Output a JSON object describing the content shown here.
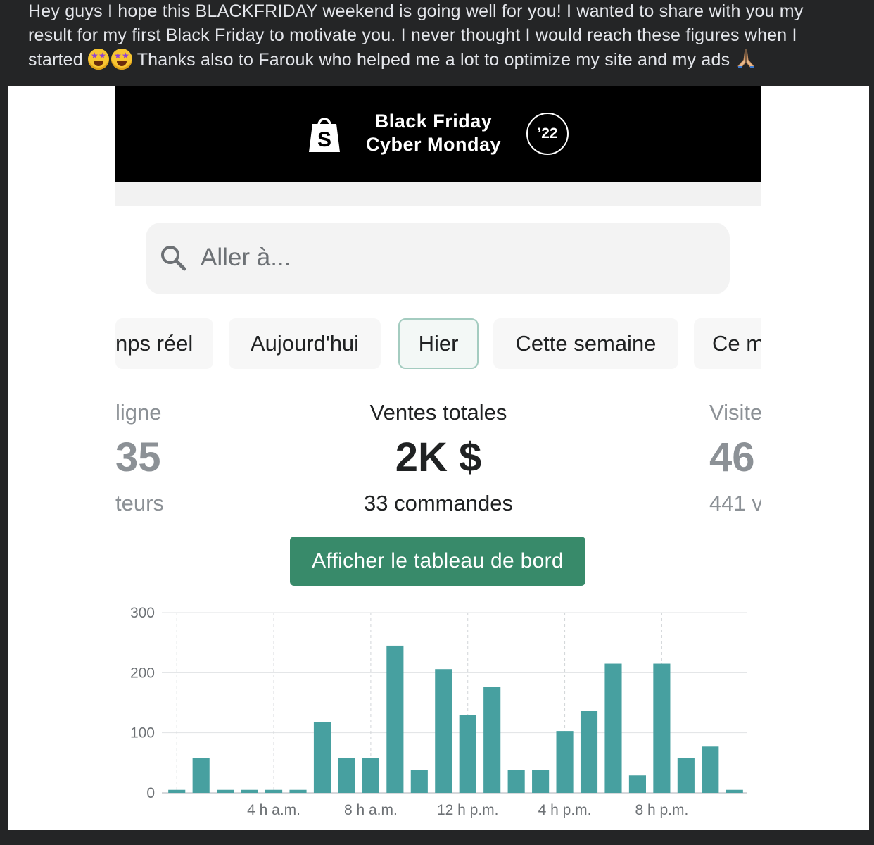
{
  "post": {
    "text_part1": "Hey guys I hope this BLACKFRIDAY weekend is going well for you! I wanted to share with you my result for my first Black Friday to motivate you. I never thought I would reach these figures when I started",
    "text_part2": "Thanks also to Farouk who helped me a lot to optimize my site and my ads",
    "emojis": [
      "star-struck-emoji",
      "star-struck-emoji",
      "folded-hands-emoji"
    ]
  },
  "banner": {
    "line1": "Black Friday",
    "line2": "Cyber Monday",
    "year": "’22",
    "logo": "shopify-bag-icon"
  },
  "search": {
    "placeholder": "Aller à..."
  },
  "tabs": [
    {
      "label": "nps réel",
      "active": false
    },
    {
      "label": "Aujourd'hui",
      "active": false
    },
    {
      "label": "Hier",
      "active": true
    },
    {
      "label": "Cette semaine",
      "active": false
    },
    {
      "label": "Ce m",
      "active": false
    }
  ],
  "metrics": {
    "left": {
      "label": "ligne",
      "value": "35",
      "sub": "teurs"
    },
    "center": {
      "label": "Ventes totales",
      "value": "2K $",
      "sub": "33 commandes"
    },
    "right": {
      "label": "Visite",
      "value": "46",
      "sub": "441 v"
    }
  },
  "dashboard_button": {
    "label": "Afficher le tableau de bord"
  },
  "colors": {
    "accent": "#388a6a",
    "bar": "#47a0a0",
    "banner_bg": "#000000"
  },
  "chart_data": {
    "type": "bar",
    "categories": [
      "0",
      "1",
      "2",
      "3",
      "4",
      "5",
      "6",
      "7",
      "8",
      "9",
      "10",
      "11",
      "12",
      "13",
      "14",
      "15",
      "16",
      "17",
      "18",
      "19",
      "20",
      "21",
      "22",
      "23"
    ],
    "values": [
      5,
      58,
      5,
      5,
      5,
      5,
      118,
      58,
      58,
      245,
      38,
      206,
      130,
      176,
      38,
      38,
      103,
      137,
      215,
      29,
      215,
      58,
      77,
      5
    ],
    "ylim": [
      0,
      300
    ],
    "yticks": [
      "0",
      "100",
      "200",
      "300"
    ],
    "xtick_labels": [
      "4 h a.m.",
      "8 h a.m.",
      "12 h p.m.",
      "4 h p.m.",
      "8 h p.m."
    ],
    "xtick_positions": [
      4,
      8,
      12,
      16,
      20
    ],
    "grid": true
  }
}
